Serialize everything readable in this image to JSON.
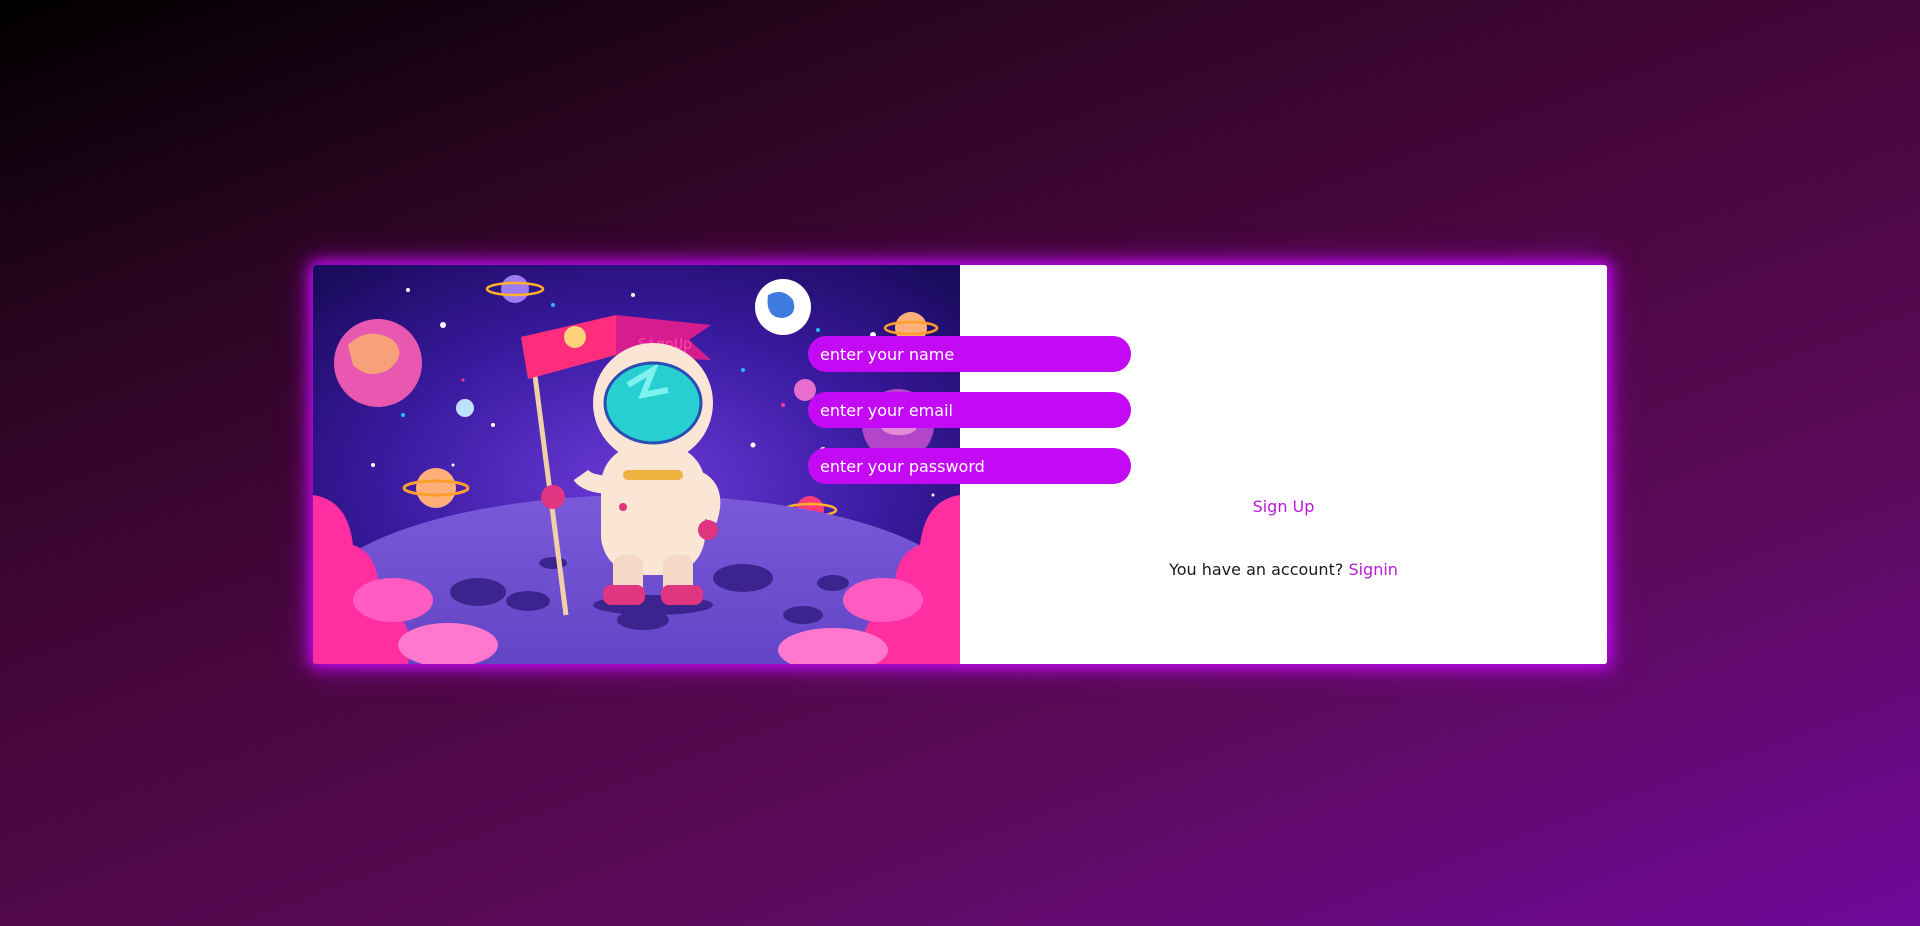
{
  "art": {
    "flag_text": "SignUp"
  },
  "form": {
    "name_placeholder": "enter your name",
    "email_placeholder": "enter your email",
    "password_placeholder": "enter your password",
    "submit_label": "Sign Up",
    "account_prompt": "You have an account?",
    "signin_label": "Signin"
  },
  "colors": {
    "accent": "#c40af5",
    "link": "#b61ad8"
  }
}
